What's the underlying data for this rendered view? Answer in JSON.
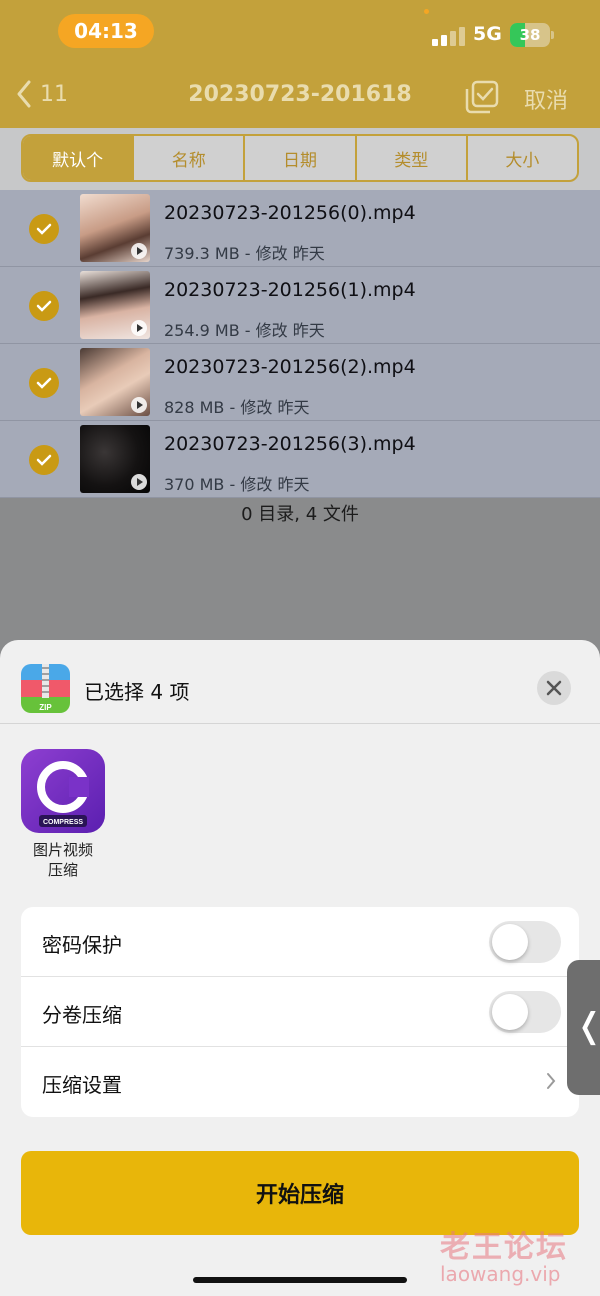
{
  "status_bar": {
    "time": "04:13",
    "network": "5G",
    "battery": "38",
    "battery_level": 0.38
  },
  "nav": {
    "back_label": "11",
    "title": "20230723-201618",
    "cancel_label": "取消"
  },
  "sort_tabs": [
    {
      "label": "默认个"
    },
    {
      "label": "名称"
    },
    {
      "label": "日期"
    },
    {
      "label": "类型"
    },
    {
      "label": "大小"
    }
  ],
  "files": [
    {
      "name": "20230723-201256(0).mp4",
      "meta": "739.3 MB - 修改 昨天"
    },
    {
      "name": "20230723-201256(1).mp4",
      "meta": "254.9 MB - 修改 昨天"
    },
    {
      "name": "20230723-201256(2).mp4",
      "meta": "828 MB - 修改 昨天"
    },
    {
      "name": "20230723-201256(3).mp4",
      "meta": "370 MB - 修改 昨天"
    }
  ],
  "summary": "0 目录, 4 文件",
  "sheet": {
    "title": "已选择 4 项",
    "zip_icon_text": "ZIP",
    "app": {
      "name_line1": "图片视频",
      "name_line2": "压缩",
      "icon_text": "COMPRESS"
    },
    "options": [
      {
        "label": "密码保护",
        "type": "toggle",
        "on": false
      },
      {
        "label": "分卷压缩",
        "type": "toggle",
        "on": false
      },
      {
        "label": "压缩设置",
        "type": "chevron"
      }
    ],
    "start_button": "开始压缩"
  },
  "watermark": {
    "line1": "老王论坛",
    "line2": "laowang.vip"
  },
  "colors": {
    "header_gold": "#c3a13b",
    "button_yellow": "#e8b60a",
    "check_gold": "#c99a14",
    "app_purple": "#7a32c8"
  },
  "icons": [
    "chevron-left-icon",
    "select-all-icon",
    "check-icon",
    "play-icon",
    "zip-icon",
    "close-icon",
    "compress-app-icon",
    "chevron-right-icon"
  ]
}
